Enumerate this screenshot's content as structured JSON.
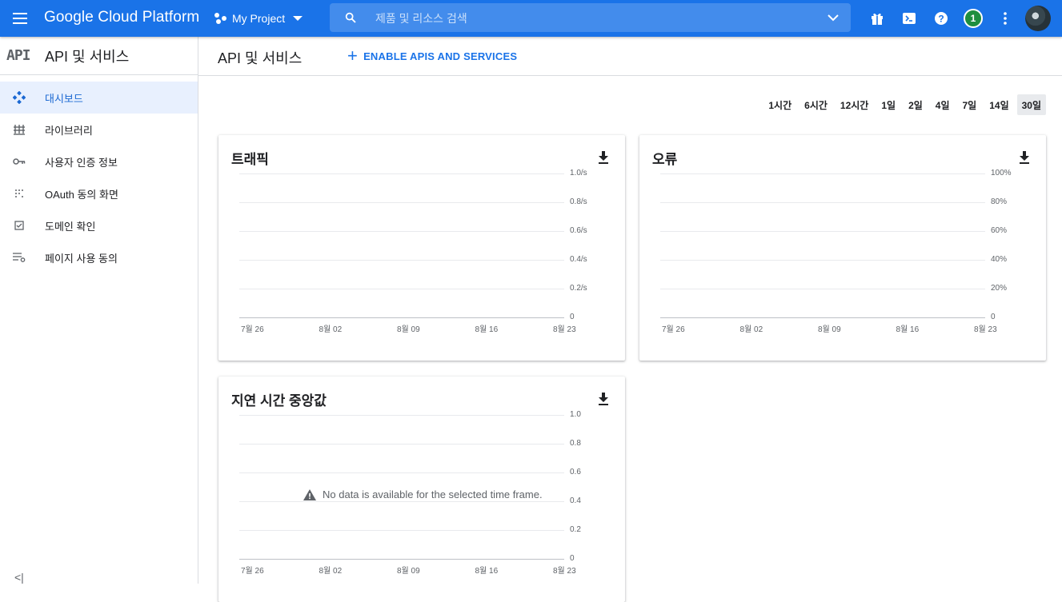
{
  "topbar": {
    "title": "Google Cloud Platform",
    "project": "My Project",
    "search_placeholder": "제품 및 리소스 검색",
    "notification_count": "1"
  },
  "sidebar": {
    "logo": "API",
    "title": "API 및 서비스",
    "items": [
      {
        "label": "대시보드",
        "icon": "dashboard-icon",
        "active": true
      },
      {
        "label": "라이브러리",
        "icon": "library-icon"
      },
      {
        "label": "사용자 인증 정보",
        "icon": "key-icon"
      },
      {
        "label": "OAuth 동의 화면",
        "icon": "oauth-icon"
      },
      {
        "label": "도메인 확인",
        "icon": "checkbox-icon"
      },
      {
        "label": "페이지 사용 동의",
        "icon": "settings-list-icon"
      }
    ],
    "collapse_label": "<|"
  },
  "main": {
    "title": "API 및 서비스",
    "enable_button": "ENABLE APIS AND SERVICES",
    "time_ranges": [
      "1시간",
      "6시간",
      "12시간",
      "1일",
      "2일",
      "4일",
      "7일",
      "14일",
      "30일"
    ],
    "selected_range": "30일"
  },
  "chart_data": [
    {
      "type": "line",
      "title": "트래픽",
      "x": [
        "7월 26",
        "8월 02",
        "8월 09",
        "8월 16",
        "8월 23"
      ],
      "yticks": [
        "1.0/s",
        "0.8/s",
        "0.6/s",
        "0.4/s",
        "0.2/s",
        "0"
      ],
      "ylim": [
        0,
        1.0
      ],
      "series": []
    },
    {
      "type": "line",
      "title": "오류",
      "x": [
        "7월 26",
        "8월 02",
        "8월 09",
        "8월 16",
        "8월 23"
      ],
      "yticks": [
        "100%",
        "80%",
        "60%",
        "40%",
        "20%",
        "0"
      ],
      "ylim": [
        0,
        100
      ],
      "series": []
    },
    {
      "type": "line",
      "title": "지연 시간 중앙값",
      "x": [
        "7월 26",
        "8월 02",
        "8월 09",
        "8월 16",
        "8월 23"
      ],
      "yticks": [
        "1.0",
        "0.8",
        "0.6",
        "0.4",
        "0.2",
        "0"
      ],
      "ylim": [
        0,
        1.0
      ],
      "series": [],
      "message": "No data is available for the selected time frame."
    }
  ]
}
